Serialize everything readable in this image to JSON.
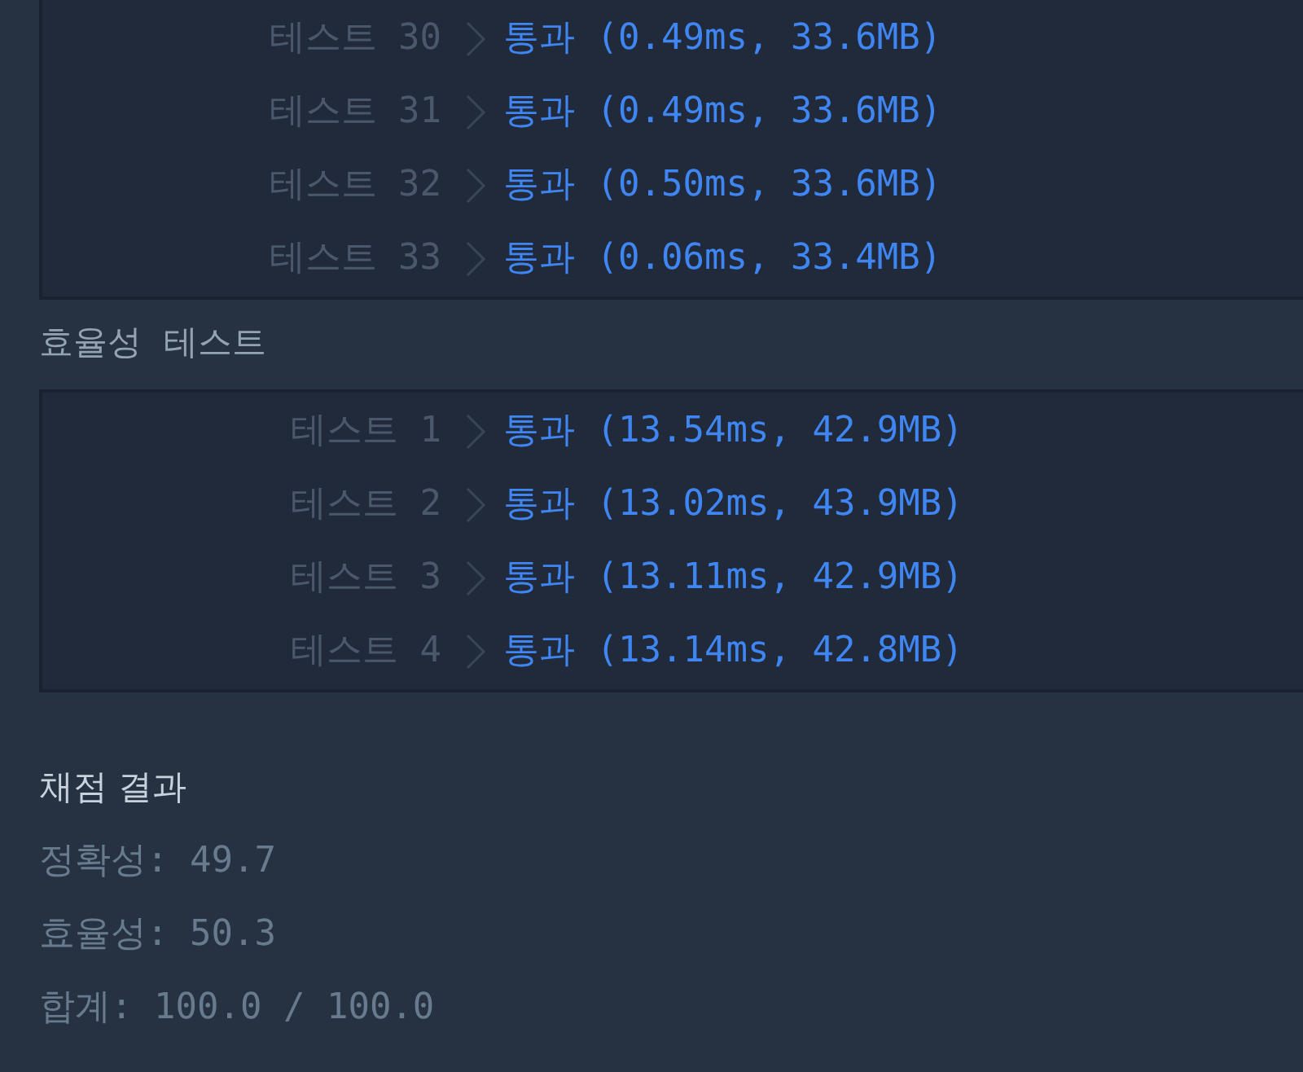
{
  "accuracy_tests": {
    "rows": [
      {
        "label": "테스트 30",
        "result": "통과 (0.49ms, 33.6MB)"
      },
      {
        "label": "테스트 31",
        "result": "통과 (0.49ms, 33.6MB)"
      },
      {
        "label": "테스트 32",
        "result": "통과 (0.50ms, 33.6MB)"
      },
      {
        "label": "테스트 33",
        "result": "통과 (0.06ms, 33.4MB)"
      }
    ]
  },
  "efficiency_tests": {
    "title": "효율성  테스트",
    "rows": [
      {
        "label": "테스트 1",
        "result": "통과 (13.54ms, 42.9MB)"
      },
      {
        "label": "테스트 2",
        "result": "통과 (13.02ms, 43.9MB)"
      },
      {
        "label": "테스트 3",
        "result": "통과 (13.11ms, 42.9MB)"
      },
      {
        "label": "테스트 4",
        "result": "통과 (13.14ms, 42.8MB)"
      }
    ]
  },
  "grading_result": {
    "title": "채점 결과",
    "lines": [
      "정확성: 49.7",
      "효율성: 50.3",
      "합계: 100.0 / 100.0"
    ]
  }
}
